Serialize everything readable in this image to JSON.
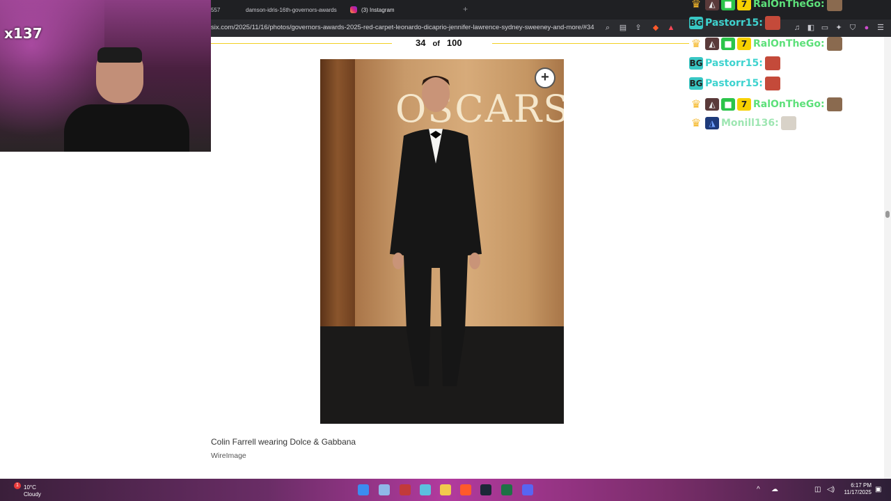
{
  "browser": {
    "tabs": [
      {
        "label": "557"
      },
      {
        "label": "damson-idris-16th-governors-awards"
      },
      {
        "label": "(3) Instagram"
      }
    ],
    "url": "six.com/2025/11/16/photos/governors-awards-2025-red-carpet-leonardo-dicaprio-jennifer-lawrence-sydney-sweeney-and-more/#34"
  },
  "gallery": {
    "current": "34",
    "of_label": "of",
    "total": "100",
    "photo_sign_text": "OSCARS",
    "caption": "Colin Farrell wearing Dolce & Gabbana",
    "credit": "WireImage"
  },
  "stream": {
    "counter_badge": "x137"
  },
  "chat": {
    "messages": [
      {
        "name": "RalOnTheGo:"
      },
      {
        "name": "Pastorr15:"
      },
      {
        "name": "RalOnTheGo:"
      },
      {
        "name": "Pastorr15:"
      },
      {
        "name": "Pastorr15:"
      },
      {
        "name": "RalOnTheGo:"
      },
      {
        "name": "Monill136:"
      }
    ]
  },
  "taskbar": {
    "weather_temp": "10°C",
    "weather_desc": "Cloudy",
    "notification_count": "1",
    "time": "6:17 PM",
    "date": "11/17/2025"
  }
}
